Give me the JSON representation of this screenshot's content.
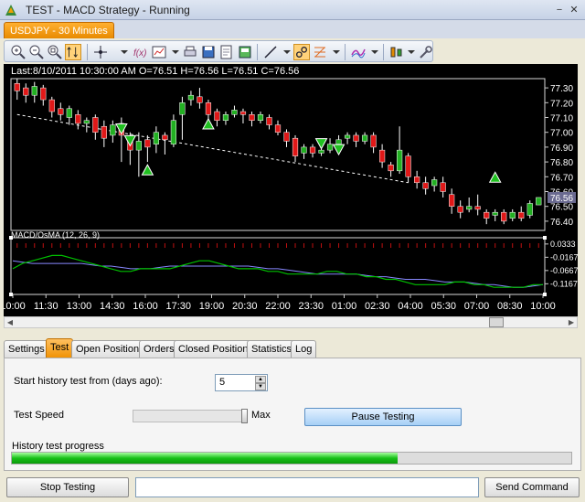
{
  "window": {
    "title": "TEST - MACD Strategy - Running",
    "minimize": "−",
    "close": "✕"
  },
  "doc_tab": {
    "label": "USDJPY - 30 Minutes"
  },
  "toolbar": {
    "icons": [
      "zoom-in-icon",
      "zoom-out-icon",
      "zoom-fit-icon",
      "auto-scale-icon",
      "crosshair-icon",
      "function-icon",
      "chart-type-icon",
      "print-icon",
      "save-icon",
      "save-image-icon",
      "export-icon",
      "line-tool-icon",
      "link-icon",
      "fibonacci-icon",
      "indicator-icon",
      "color-icon",
      "settings-icon"
    ]
  },
  "chart": {
    "info": "Last:8/10/2011 10:30:00 AM O=76.51 H=76.56 L=76.51 C=76.56",
    "price_ticks": [
      "77.30",
      "77.20",
      "77.10",
      "77.00",
      "76.90",
      "76.80",
      "76.70",
      "76.60",
      "76.50",
      "76.40"
    ],
    "last_price": "76.56",
    "indicator_label": "MACD/OsMA (12, 26, 9)",
    "macd_ticks": [
      "0.0333",
      "-0.0167",
      "-0.0667",
      "-0.1167"
    ],
    "time_ticks": [
      "10:00",
      "11:30",
      "13:00",
      "14:30",
      "16:00",
      "17:30",
      "19:00",
      "20:30",
      "22:00",
      "23:30",
      "01:00",
      "02:30",
      "04:00",
      "05:30",
      "07:00",
      "08:30",
      "10:00"
    ],
    "colors": {
      "up": "#22b022",
      "down": "#e01818",
      "macd": "#00c000",
      "signal": "#8888ff",
      "background": "#000000",
      "trend": "#ffffff"
    }
  },
  "chart_data": {
    "type": "candlestick",
    "symbol": "USDJPY",
    "timeframe": "30 Minutes",
    "last": {
      "date": "8/10/2011 10:30:00 AM",
      "open": 76.51,
      "high": 76.56,
      "low": 76.51,
      "close": 76.56
    },
    "ylim": [
      76.35,
      77.35
    ],
    "candles": [
      {
        "o": 77.33,
        "c": 77.28,
        "h": 77.36,
        "l": 77.22
      },
      {
        "o": 77.3,
        "c": 77.25,
        "h": 77.33,
        "l": 77.2
      },
      {
        "o": 77.25,
        "c": 77.31,
        "h": 77.34,
        "l": 77.2
      },
      {
        "o": 77.3,
        "c": 77.22,
        "h": 77.32,
        "l": 77.18
      },
      {
        "o": 77.22,
        "c": 77.14,
        "h": 77.24,
        "l": 77.1
      },
      {
        "o": 77.16,
        "c": 77.12,
        "h": 77.2,
        "l": 77.08
      },
      {
        "o": 77.1,
        "c": 77.16,
        "h": 77.18,
        "l": 77.05
      },
      {
        "o": 77.12,
        "c": 77.06,
        "h": 77.15,
        "l": 77.02
      },
      {
        "o": 77.06,
        "c": 77.08,
        "h": 77.1,
        "l": 77.0
      },
      {
        "o": 77.1,
        "c": 77.0,
        "h": 77.12,
        "l": 76.95
      },
      {
        "o": 77.04,
        "c": 76.96,
        "h": 77.08,
        "l": 76.9
      },
      {
        "o": 76.98,
        "c": 77.05,
        "h": 77.08,
        "l": 76.93
      },
      {
        "o": 77.06,
        "c": 76.98,
        "h": 77.1,
        "l": 76.8
      },
      {
        "o": 76.95,
        "c": 76.88,
        "h": 77.0,
        "l": 76.78
      },
      {
        "o": 76.88,
        "c": 76.94,
        "h": 77.0,
        "l": 76.7
      },
      {
        "o": 76.95,
        "c": 76.9,
        "h": 76.98,
        "l": 76.8
      },
      {
        "o": 76.92,
        "c": 77.0,
        "h": 77.04,
        "l": 76.86
      },
      {
        "o": 76.98,
        "c": 76.95,
        "h": 77.0,
        "l": 76.85
      },
      {
        "o": 76.92,
        "c": 77.08,
        "h": 77.12,
        "l": 76.9
      },
      {
        "o": 77.12,
        "c": 77.2,
        "h": 77.24,
        "l": 76.95
      },
      {
        "o": 77.22,
        "c": 77.25,
        "h": 77.28,
        "l": 77.18
      },
      {
        "o": 77.24,
        "c": 77.2,
        "h": 77.3,
        "l": 77.16
      },
      {
        "o": 77.2,
        "c": 77.12,
        "h": 77.22,
        "l": 77.08
      },
      {
        "o": 77.14,
        "c": 77.08,
        "h": 77.16,
        "l": 77.04
      },
      {
        "o": 77.08,
        "c": 77.12,
        "h": 77.14,
        "l": 77.05
      },
      {
        "o": 77.12,
        "c": 77.15,
        "h": 77.18,
        "l": 77.1
      },
      {
        "o": 77.14,
        "c": 77.12,
        "h": 77.16,
        "l": 77.06
      },
      {
        "o": 77.12,
        "c": 77.08,
        "h": 77.14,
        "l": 77.04
      },
      {
        "o": 77.08,
        "c": 77.12,
        "h": 77.14,
        "l": 77.06
      },
      {
        "o": 77.1,
        "c": 77.05,
        "h": 77.12,
        "l": 77.02
      },
      {
        "o": 77.05,
        "c": 77.0,
        "h": 77.08,
        "l": 76.98
      },
      {
        "o": 77.0,
        "c": 76.94,
        "h": 77.02,
        "l": 76.9
      },
      {
        "o": 76.96,
        "c": 76.84,
        "h": 76.98,
        "l": 76.8
      },
      {
        "o": 76.86,
        "c": 76.9,
        "h": 76.92,
        "l": 76.82
      },
      {
        "o": 76.9,
        "c": 76.86,
        "h": 76.92,
        "l": 76.83
      },
      {
        "o": 76.86,
        "c": 76.88,
        "h": 76.9,
        "l": 76.84
      },
      {
        "o": 76.88,
        "c": 76.92,
        "h": 76.96,
        "l": 76.86
      },
      {
        "o": 76.92,
        "c": 76.95,
        "h": 76.98,
        "l": 76.9
      },
      {
        "o": 76.96,
        "c": 76.98,
        "h": 77.0,
        "l": 76.92
      },
      {
        "o": 76.98,
        "c": 76.94,
        "h": 77.0,
        "l": 76.9
      },
      {
        "o": 76.94,
        "c": 76.98,
        "h": 77.0,
        "l": 76.92
      },
      {
        "o": 76.98,
        "c": 76.9,
        "h": 77.0,
        "l": 76.86
      },
      {
        "o": 76.88,
        "c": 76.8,
        "h": 76.92,
        "l": 76.76
      },
      {
        "o": 76.78,
        "c": 76.74,
        "h": 76.8,
        "l": 76.7
      },
      {
        "o": 76.74,
        "c": 76.88,
        "h": 77.04,
        "l": 76.72
      },
      {
        "o": 76.84,
        "c": 76.7,
        "h": 76.86,
        "l": 76.66
      },
      {
        "o": 76.7,
        "c": 76.66,
        "h": 76.74,
        "l": 76.62
      },
      {
        "o": 76.66,
        "c": 76.62,
        "h": 76.7,
        "l": 76.58
      },
      {
        "o": 76.64,
        "c": 76.68,
        "h": 76.7,
        "l": 76.6
      },
      {
        "o": 76.66,
        "c": 76.6,
        "h": 76.7,
        "l": 76.56
      },
      {
        "o": 76.58,
        "c": 76.5,
        "h": 76.62,
        "l": 76.45
      },
      {
        "o": 76.5,
        "c": 76.46,
        "h": 76.54,
        "l": 76.42
      },
      {
        "o": 76.48,
        "c": 76.5,
        "h": 76.56,
        "l": 76.46
      },
      {
        "o": 76.5,
        "c": 76.48,
        "h": 76.58,
        "l": 76.44
      },
      {
        "o": 76.46,
        "c": 76.42,
        "h": 76.48,
        "l": 76.38
      },
      {
        "o": 76.44,
        "c": 76.46,
        "h": 76.48,
        "l": 76.4
      },
      {
        "o": 76.46,
        "c": 76.4,
        "h": 76.48,
        "l": 76.38
      },
      {
        "o": 76.42,
        "c": 76.46,
        "h": 76.48,
        "l": 76.4
      },
      {
        "o": 76.46,
        "c": 76.42,
        "h": 76.5,
        "l": 76.4
      },
      {
        "o": 76.44,
        "c": 76.52,
        "h": 76.54,
        "l": 76.42
      },
      {
        "o": 76.51,
        "c": 76.56,
        "h": 76.56,
        "l": 76.51
      }
    ],
    "signals": [
      {
        "index": 12,
        "type": "sell",
        "price": 77.02
      },
      {
        "index": 13,
        "type": "sell",
        "price": 76.94
      },
      {
        "index": 15,
        "type": "buy",
        "price": 76.75
      },
      {
        "index": 22,
        "type": "buy",
        "price": 77.06
      },
      {
        "index": 35,
        "type": "sell",
        "price": 76.92
      },
      {
        "index": 37,
        "type": "sell",
        "price": 76.88
      },
      {
        "index": 55,
        "type": "buy",
        "price": 76.7
      }
    ],
    "macd": {
      "ylim": [
        -0.15,
        0.05
      ],
      "macd_line": [
        -0.06,
        -0.04,
        -0.03,
        -0.02,
        -0.01,
        -0.01,
        -0.02,
        -0.03,
        -0.04,
        -0.05,
        -0.06,
        -0.07,
        -0.07,
        -0.06,
        -0.06,
        -0.06,
        -0.06,
        -0.05,
        -0.04,
        -0.03,
        -0.03,
        -0.04,
        -0.05,
        -0.06,
        -0.06,
        -0.06,
        -0.07,
        -0.07,
        -0.08,
        -0.08,
        -0.08,
        -0.08,
        -0.07,
        -0.07,
        -0.08,
        -0.08,
        -0.09,
        -0.09,
        -0.1,
        -0.1,
        -0.11,
        -0.12,
        -0.12,
        -0.12,
        -0.12,
        -0.11,
        -0.11,
        -0.12,
        -0.12,
        -0.13,
        -0.13,
        -0.13,
        -0.13,
        -0.12,
        -0.12
      ],
      "signal_line": [
        -0.03,
        -0.035,
        -0.04,
        -0.04,
        -0.04,
        -0.04,
        -0.04,
        -0.04,
        -0.045,
        -0.05,
        -0.05,
        -0.055,
        -0.06,
        -0.06,
        -0.06,
        -0.055,
        -0.05,
        -0.05,
        -0.05,
        -0.05,
        -0.05,
        -0.05,
        -0.05,
        -0.05,
        -0.05,
        -0.055,
        -0.06,
        -0.06,
        -0.065,
        -0.07,
        -0.075,
        -0.08,
        -0.08,
        -0.08,
        -0.08,
        -0.08,
        -0.085,
        -0.09,
        -0.09,
        -0.095,
        -0.1,
        -0.1,
        -0.1,
        -0.105,
        -0.11,
        -0.11,
        -0.11,
        -0.115,
        -0.12,
        -0.12,
        -0.125,
        -0.13,
        -0.13,
        -0.125,
        -0.12
      ]
    }
  },
  "bottom_tabs": [
    "Settings",
    "Test",
    "Open Positions",
    "Orders",
    "Closed Positions",
    "Statistics",
    "Log"
  ],
  "active_tab": "Test",
  "test_panel": {
    "start_label": "Start history test from (days ago):",
    "start_value": "5",
    "speed_label": "Test Speed",
    "speed_max_label": "Max",
    "speed_value": 1.0,
    "pause_button": "Pause Testing",
    "progress_label": "History test progress",
    "progress": 0.69
  },
  "bottom_bar": {
    "stop_button": "Stop Testing",
    "command_value": "",
    "send_button": "Send Command"
  }
}
